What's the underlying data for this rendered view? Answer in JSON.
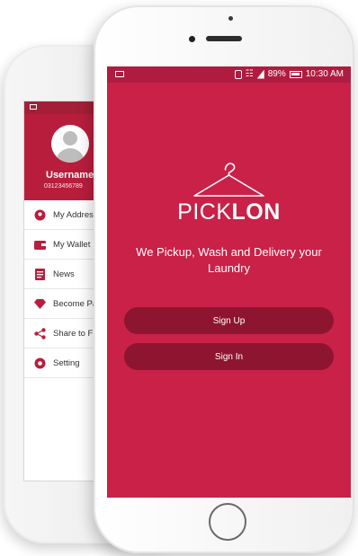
{
  "back_screen": {
    "username": "Username",
    "phone": "03123456789",
    "menu": [
      {
        "label": "My Addres",
        "icon": "pin-icon"
      },
      {
        "label": "My Wallet",
        "icon": "wallet-icon"
      },
      {
        "label": "News",
        "icon": "news-icon"
      },
      {
        "label": "Become Pa",
        "icon": "diamond-icon"
      },
      {
        "label": "Share to Fr",
        "icon": "share-icon"
      },
      {
        "label": "Setting",
        "icon": "gear-icon"
      }
    ]
  },
  "front_screen": {
    "status": {
      "battery": "89%",
      "time": "10:30 AM"
    },
    "logo": {
      "light": "PICK",
      "bold": "LON"
    },
    "tagline": "We Pickup, Wash and Delivery your Laundry",
    "buttons": {
      "signup": "Sign Up",
      "signin": "Sign In"
    }
  },
  "colors": {
    "brand": "#c92148",
    "brand_dark": "#8e1530",
    "status_bar": "#b01c40"
  }
}
